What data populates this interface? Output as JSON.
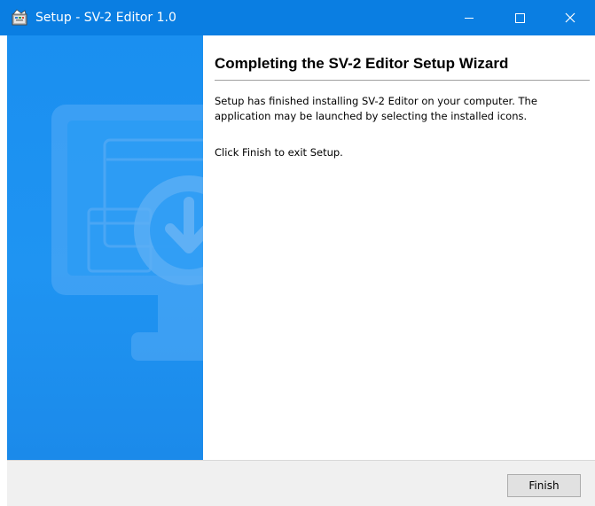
{
  "window": {
    "title": "Setup - SV-2 Editor 1.0",
    "accent_color": "#0a7ee2",
    "banner_color": "#1f94f2",
    "app_icon": "setup-app-icon",
    "caption_buttons": [
      "minimize-icon",
      "maximize-icon",
      "close-icon"
    ]
  },
  "banner": {
    "illustration": "monitor-download-icon"
  },
  "content": {
    "heading": "Completing the SV-2 Editor Setup Wizard",
    "paragraph1": "Setup has finished installing SV-2 Editor on your computer. The application may be launched by selecting the installed icons.",
    "paragraph2": "Click Finish to exit Setup."
  },
  "footer": {
    "finish_label": "Finish"
  }
}
